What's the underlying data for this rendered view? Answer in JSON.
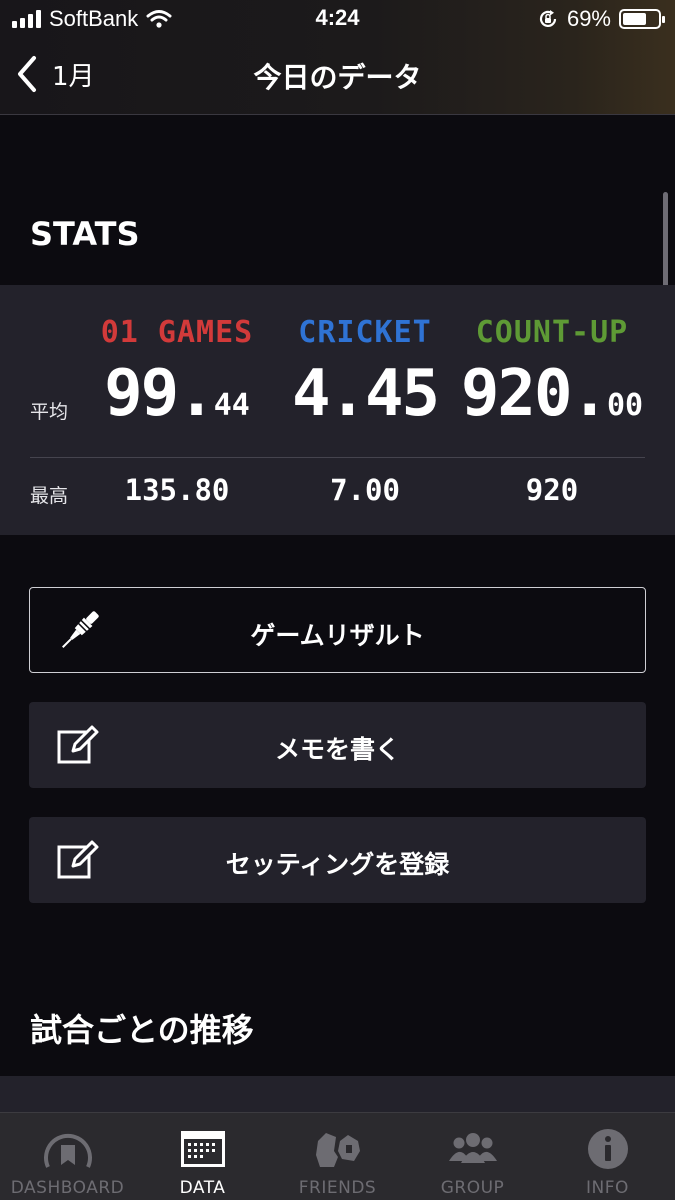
{
  "status_bar": {
    "carrier": "SoftBank",
    "time": "4:24",
    "battery_percent": "69%",
    "battery_level": 0.69
  },
  "nav": {
    "back_label": "1月",
    "title": "今日のデータ"
  },
  "stats": {
    "section_title": "STATS",
    "row_labels": {
      "average": "平均",
      "max": "最高"
    },
    "columns": [
      {
        "name": "01 GAMES",
        "color": "#d23a3a",
        "average_int": "99.",
        "average_dec": "44",
        "max": "135.80"
      },
      {
        "name": "CRICKET",
        "color": "#2f73d4",
        "average_int": "4.45",
        "average_dec": "",
        "max": "7.00"
      },
      {
        "name": "COUNT-UP",
        "color": "#5e9a35",
        "average_int": "920.",
        "average_dec": "00",
        "max": "920"
      }
    ]
  },
  "actions": [
    {
      "label": "ゲームリザルト",
      "icon": "dart-icon"
    },
    {
      "label": "メモを書く",
      "icon": "edit-icon"
    },
    {
      "label": "セッティングを登録",
      "icon": "edit-icon"
    }
  ],
  "trend_section_title": "試合ごとの推移",
  "tabs": [
    {
      "label": "DASHBOARD",
      "icon": "dashboard-gauge-icon",
      "active": false
    },
    {
      "label": "DATA",
      "icon": "calendar-icon",
      "active": true
    },
    {
      "label": "FRIENDS",
      "icon": "friends-icon",
      "active": false
    },
    {
      "label": "GROUP",
      "icon": "group-icon",
      "active": false
    },
    {
      "label": "INFO",
      "icon": "info-icon",
      "active": false
    }
  ]
}
